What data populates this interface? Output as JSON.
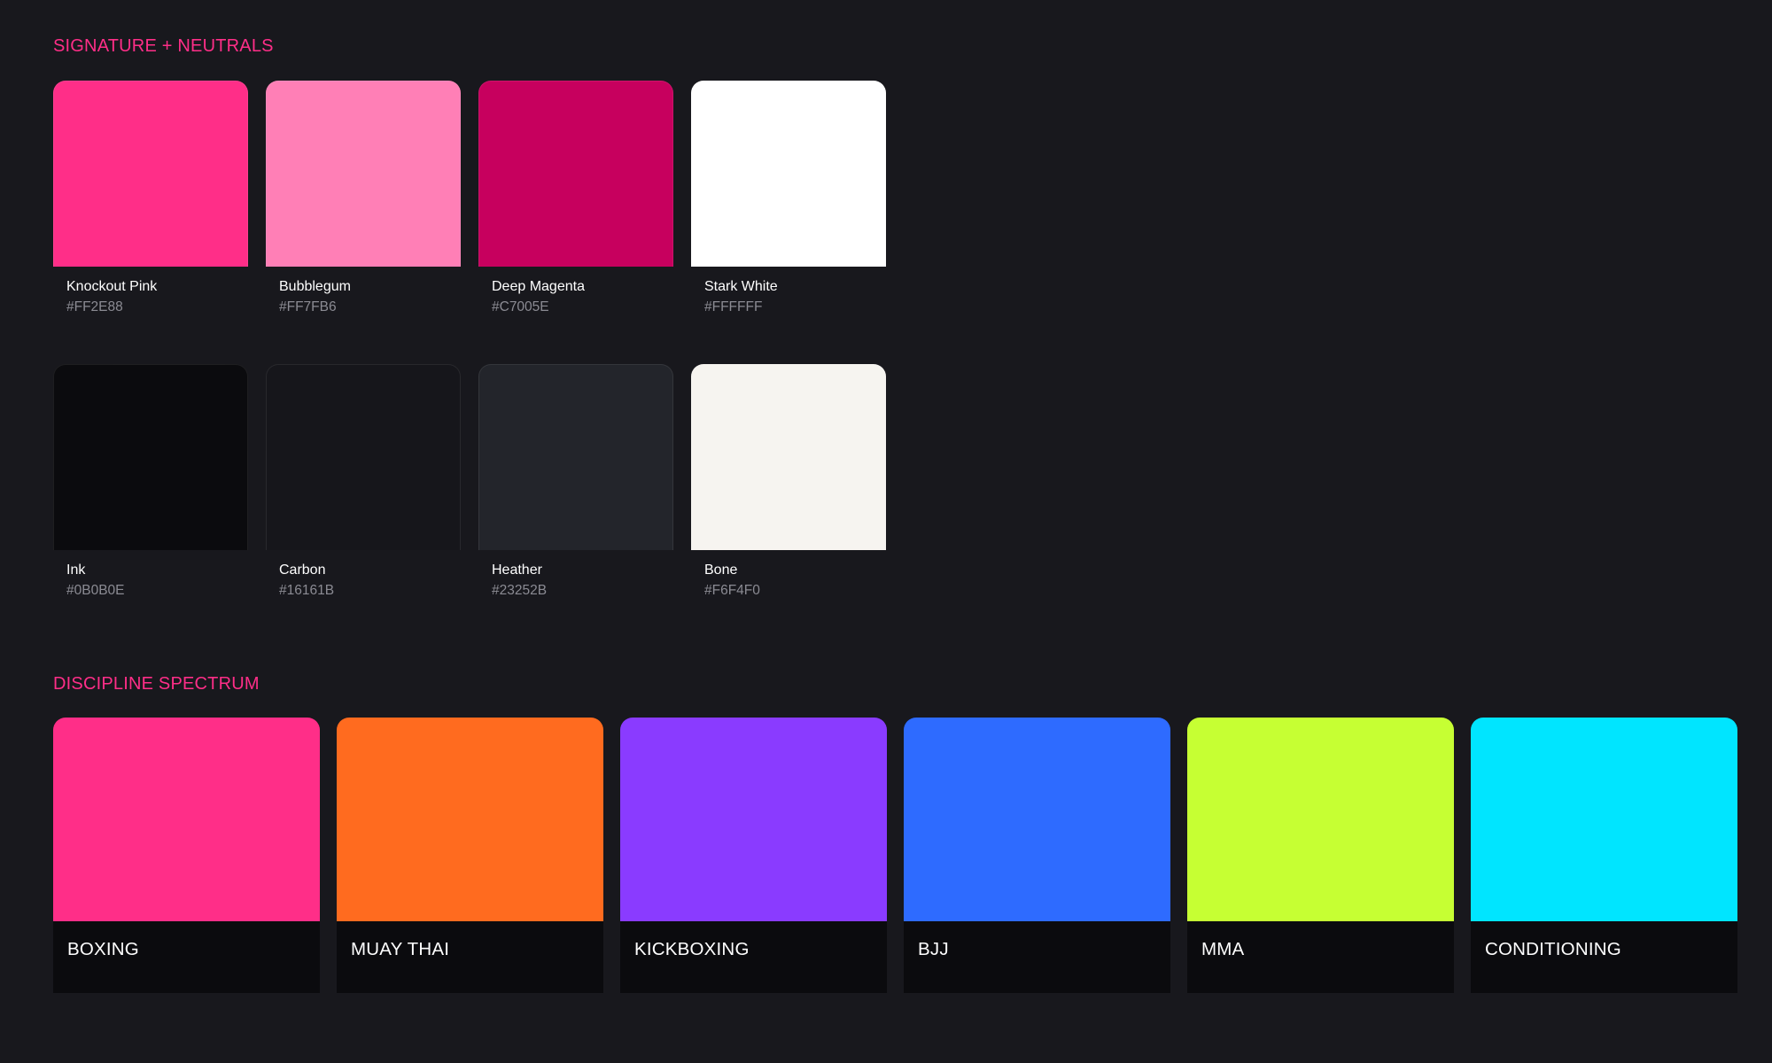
{
  "sections": {
    "signature_neutrals": {
      "title": "SIGNATURE + NEUTRALS",
      "signature": [
        {
          "name": "Knockout Pink",
          "hex": "#FF2E88",
          "color": "#FF2E88"
        },
        {
          "name": "Bubblegum",
          "hex": "#FF7FB6",
          "color": "#FF7FB6"
        },
        {
          "name": "Deep Magenta",
          "hex": "#C7005E",
          "color": "#C7005E"
        },
        {
          "name": "Stark White",
          "hex": "#FFFFFF",
          "color": "#FFFFFF"
        }
      ],
      "neutrals": [
        {
          "name": "Ink",
          "hex": "#0B0B0E",
          "color": "#0B0B0E"
        },
        {
          "name": "Carbon",
          "hex": "#16161B",
          "color": "#16161B"
        },
        {
          "name": "Heather",
          "hex": "#23252B",
          "color": "#23252B"
        },
        {
          "name": "Bone",
          "hex": "#F6F4F0",
          "color": "#F6F4F0"
        }
      ]
    },
    "discipline": {
      "title": "DISCIPLINE SPECTRUM",
      "items": [
        {
          "label": "BOXING",
          "color": "#FF2E88"
        },
        {
          "label": "MUAY THAI",
          "color": "#FF6B1F"
        },
        {
          "label": "KICKBOXING",
          "color": "#8A3BFF"
        },
        {
          "label": "BJJ",
          "color": "#2E6BFF"
        },
        {
          "label": "MMA",
          "color": "#C6FF33"
        },
        {
          "label": "CONDITIONING",
          "color": "#00E5FF"
        }
      ]
    }
  },
  "theme": {
    "background": "#18181D",
    "accent": "#FF2E88"
  }
}
